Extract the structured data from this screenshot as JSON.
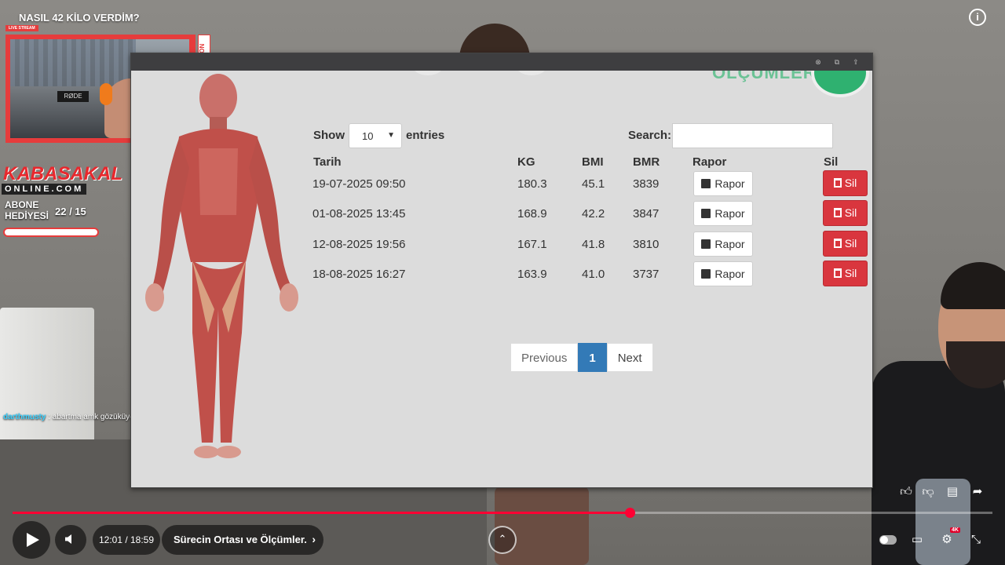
{
  "video": {
    "title": "NASIL 42 KİLO VERDİM?",
    "time": "12:01 / 18:59",
    "chapter": "Sürecin Ortası ve Ölçümler.",
    "progress": 0.63,
    "quality_badge": "4K"
  },
  "overlay": {
    "live_badge": "LIVE STREAM",
    "sponsor": "ZEON",
    "brand": "KABASAKAL",
    "brand_sub": "ONLINE.COM",
    "goal_label_1": "ABONE",
    "goal_label_2": "HEDİYESİ",
    "goal_count": "22  / 15",
    "cam_mic_label": "RØDE",
    "chat_user": "darthmusty",
    "chat_message": ": abartma amk gözüküyon"
  },
  "page": {
    "heading": "ÖLÇÜMLER",
    "show_label": "Show",
    "entries_label": "entries",
    "entries_value": "10",
    "search_label": "Search:",
    "search_value": "",
    "columns": [
      "Tarih",
      "KG",
      "BMI",
      "BMR",
      "Rapor",
      "Sil"
    ],
    "rows": [
      {
        "tarih": "19-07-2025 09:50",
        "kg": "180.3",
        "bmi": "45.1",
        "bmr": "3839",
        "rapor": "Rapor",
        "sil": "Sil"
      },
      {
        "tarih": "01-08-2025 13:45",
        "kg": "168.9",
        "bmi": "42.2",
        "bmr": "3847",
        "rapor": "Rapor",
        "sil": "Sil"
      },
      {
        "tarih": "12-08-2025 19:56",
        "kg": "167.1",
        "bmi": "41.8",
        "bmr": "3810",
        "rapor": "Rapor",
        "sil": "Sil"
      },
      {
        "tarih": "18-08-2025 16:27",
        "kg": "163.9",
        "bmi": "41.0",
        "bmr": "3737",
        "rapor": "Rapor",
        "sil": "Sil"
      }
    ],
    "pagination": {
      "previous": "Previous",
      "current": "1",
      "next": "Next"
    }
  },
  "colors": {
    "accent_red": "#d9363e",
    "pagination_active": "#337ab7",
    "progress_red": "#ff0033",
    "brand_red": "#e63c3c"
  }
}
